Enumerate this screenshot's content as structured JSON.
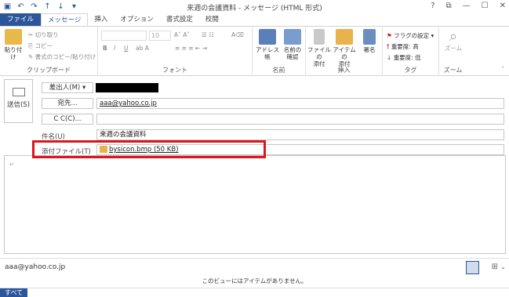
{
  "window": {
    "title": "来週の会議資料 - メッセージ (HTML 形式)",
    "help": "?",
    "restore": "⧉",
    "minimize": "—",
    "maximize": "☐",
    "close": "✕"
  },
  "tabs": [
    {
      "label": "ファイル"
    },
    {
      "label": "メッセージ"
    },
    {
      "label": "挿入"
    },
    {
      "label": "オプション"
    },
    {
      "label": "書式設定"
    },
    {
      "label": "校閲"
    }
  ],
  "ribbon": {
    "clipboard": {
      "paste": "貼り付け",
      "cut": "切り取り",
      "copy": "コピー",
      "format_painter": "書式のコピー/貼り付け",
      "label": "クリップボード"
    },
    "font": {
      "size": "10",
      "bold": "B",
      "italic": "I",
      "underline": "U",
      "label": "フォント"
    },
    "names": {
      "address_book": "アドレス帳",
      "check_names_1": "名前の",
      "check_names_2": "確認",
      "label": "名前"
    },
    "include": {
      "attach_file_1": "ファイルの",
      "attach_file_2": "添付",
      "attach_item_1": "アイテムの",
      "attach_item_2": "添付",
      "signature": "署名",
      "label": "挿入"
    },
    "tags": {
      "follow_up": "フラグの設定",
      "high_importance": "重要度: 高",
      "low_importance": "重要度: 低",
      "label": "タグ"
    },
    "zoom": {
      "zoom": "ズーム",
      "label": "ズーム"
    }
  },
  "compose": {
    "send_label": "送信(S)",
    "from_button": "差出人(M)",
    "to_button": "宛先...",
    "to_value": "aaa@yahoo.co.jp",
    "cc_button": "C C(C)...",
    "cc_value": "",
    "subject_label": "件名(U)",
    "subject_value": "来週の会議資料",
    "attach_label": "添付ファイル(T)",
    "attach_value": "bysicon.bmp (50 KB)",
    "body_mark": "↵"
  },
  "people_pane": {
    "email": "aaa@yahoo.co.jp"
  },
  "status": {
    "message": "このビューにはアイテムがありません。",
    "all_tab": "すべて"
  }
}
